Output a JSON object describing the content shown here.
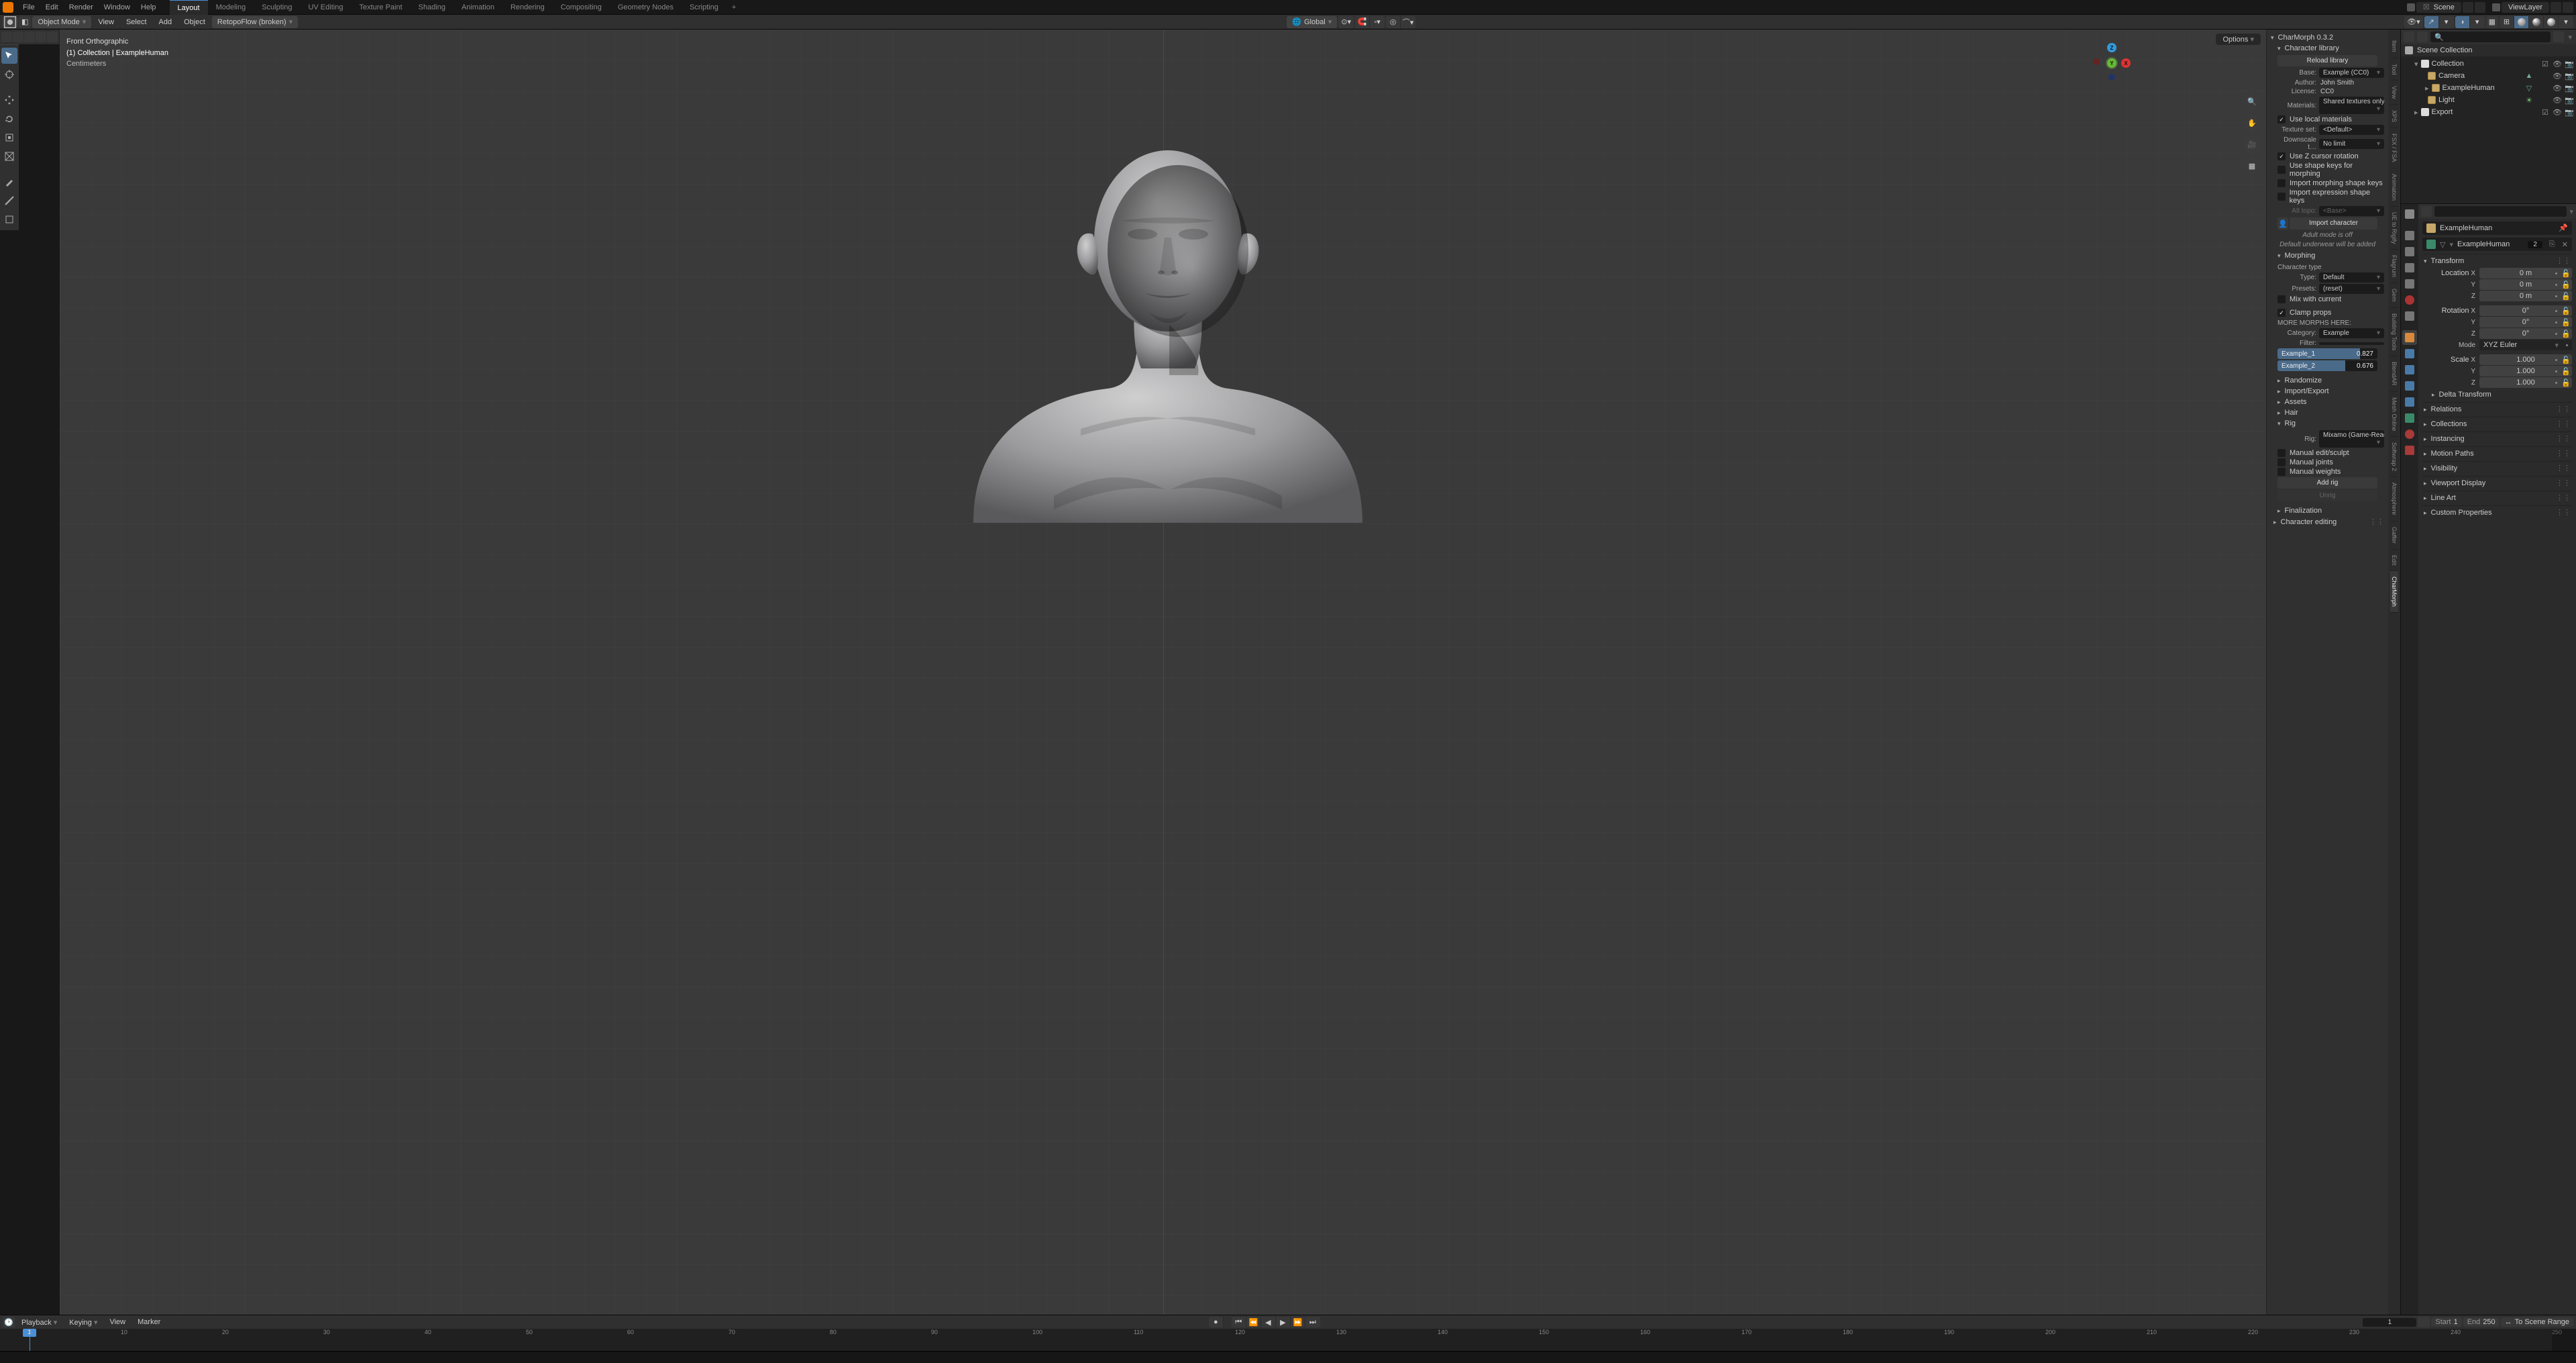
{
  "top_menu": [
    "File",
    "Edit",
    "Render",
    "Window",
    "Help"
  ],
  "workspaces": [
    "Layout",
    "Modeling",
    "Sculpting",
    "UV Editing",
    "Texture Paint",
    "Shading",
    "Animation",
    "Rendering",
    "Compositing",
    "Geometry Nodes",
    "Scripting"
  ],
  "active_workspace": "Layout",
  "scene_label": "Scene",
  "viewlayer_label": "ViewLayer",
  "header2": {
    "mode": "Object Mode",
    "menus": [
      "View",
      "Select",
      "Add",
      "Object"
    ],
    "retopoflow": "RetopoFlow (broken)",
    "orientation": "Global",
    "options_label": "Options"
  },
  "overlay": {
    "line1": "Front Orthographic",
    "line2": "(1) Collection | ExampleHuman",
    "line3": "Centimeters"
  },
  "side_tabs": [
    "Item",
    "Tool",
    "View",
    "XPS",
    "FSX / FSA",
    "Animation",
    "UE to Rigify",
    "Flagrum",
    "Gem",
    "Building Tools",
    "BlendAR",
    "Mesh Online",
    "Softwrap 2",
    "Atmosphere",
    "Gaffer",
    "Edit",
    "CharMorph"
  ],
  "active_side_tab": "CharMorph",
  "charmorph": {
    "title": "CharMorph 0.3.2",
    "lib_title": "Character library",
    "reload_btn": "Reload library",
    "base_lbl": "Base:",
    "base_val": "Example (CC0)",
    "author_lbl": "Author:",
    "author_val": "John Smith",
    "license_lbl": "License:",
    "license_val": "CC0",
    "materials_lbl": "Materials:",
    "materials_val": "Shared textures only",
    "use_local_materials": "Use local materials",
    "texset_lbl": "Texture set:",
    "texset_val": "<Default>",
    "down_lbl": "Downscale t…",
    "down_val": "No limit",
    "use_z_cursor": "Use Z cursor rotation",
    "use_shape_keys": "Use shape keys for morphing",
    "import_morph_sk": "Import morphing shape keys",
    "import_expr_sk": "Import expression shape keys",
    "alt_topo_lbl": "Alt topo:",
    "alt_topo_val": "<Base>",
    "import_char_btn": "Import character",
    "adult_off": "Adult mode is off",
    "underwear": "Default underwear will be added",
    "morph_title": "Morphing",
    "char_type_lbl": "Character type",
    "type_lbl": "Type:",
    "type_val": "Default",
    "presets_lbl": "Presets:",
    "presets_val": "(reset)",
    "mix_current": "Mix with current",
    "clamp_props": "Clamp props",
    "more_morphs": "MORE MORPHS HERE:",
    "category_lbl": "Category:",
    "category_val": "Example",
    "filter_lbl": "Filter:",
    "sliders": [
      {
        "name": "Example_1",
        "value": 0.827
      },
      {
        "name": "Example_2",
        "value": 0.676
      }
    ],
    "closed_sections": [
      "Randomize",
      "Import/Export",
      "Assets",
      "Hair"
    ],
    "rig_title": "Rig",
    "rig_lbl": "Rig:",
    "rig_val": "Mixamo (Game-Ready)",
    "rig_checks": [
      "Manual edit/sculpt",
      "Manual joints",
      "Manual weights"
    ],
    "add_rig_btn": "Add rig",
    "unrig_btn": "Unrig",
    "final_title": "Finalization",
    "charedit_title": "Character editing"
  },
  "outliner": {
    "title": "Scene Collection",
    "collection": "Collection",
    "items": [
      "Camera",
      "ExampleHuman",
      "Light",
      "Export"
    ]
  },
  "props": {
    "object_name": "ExampleHuman",
    "mesh_name": "ExampleHuman",
    "users": "2",
    "transform": "Transform",
    "location": "Location",
    "rotation": "Rotation",
    "scale": "Scale",
    "mode_lbl": "Mode",
    "mode_val": "XYZ Euler",
    "loc_vals": [
      "0 m",
      "0 m",
      "0 m"
    ],
    "rot_vals": [
      "0°",
      "0°",
      "0°"
    ],
    "scale_vals": [
      "1.000",
      "1.000",
      "1.000"
    ],
    "closed": [
      "Delta Transform",
      "Relations",
      "Collections",
      "Instancing",
      "Motion Paths",
      "Visibility",
      "Viewport Display",
      "Line Art",
      "Custom Properties"
    ]
  },
  "timeline": {
    "menus": [
      "Playback",
      "Keying",
      "View",
      "Marker"
    ],
    "frame": "1",
    "start_lbl": "Start",
    "start_val": "1",
    "end_lbl": "End",
    "end_val": "250",
    "to_scene_range": "To Scene Range",
    "ticks": [
      1,
      10,
      20,
      30,
      40,
      50,
      60,
      70,
      80,
      90,
      100,
      110,
      120,
      130,
      140,
      150,
      160,
      170,
      180,
      190,
      200,
      210,
      220,
      230,
      240,
      250
    ]
  }
}
